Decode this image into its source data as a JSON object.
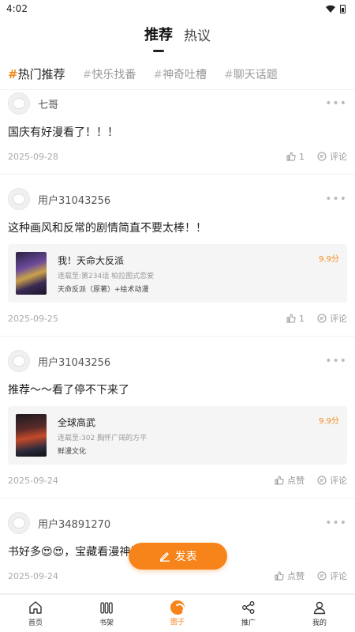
{
  "status": {
    "time": "4:02"
  },
  "tabs": [
    {
      "label": "推荐"
    },
    {
      "label": "热议"
    }
  ],
  "topics": [
    {
      "hash": "#",
      "label": "热门推荐"
    },
    {
      "hash": "#",
      "label": "快乐找番"
    },
    {
      "hash": "#",
      "label": "神奇吐槽"
    },
    {
      "hash": "#",
      "label": "聊天话题"
    }
  ],
  "posts": [
    {
      "user": "七哥",
      "text": "国庆有好漫看了！！！",
      "date": "2025-09-28",
      "like_label": "1",
      "comment_label": "评论"
    },
    {
      "user": "用户31043256",
      "text": "这种画风和反常的剧情简直不要太棒！！",
      "date": "2025-09-25",
      "like_label": "1",
      "comment_label": "评论",
      "comic": {
        "title": "我！天命大反派",
        "sub": "连载至:第234话 柏拉图式恋爱",
        "tags": "天命反派（原著）+绘术动漫",
        "score": "9.9分"
      }
    },
    {
      "user": "用户31043256",
      "text": "推荐～～看了停不下来了",
      "date": "2025-09-24",
      "like_label": "点赞",
      "comment_label": "评论",
      "comic": {
        "title": "全球高武",
        "sub": "连载至:302 胸怀广阔的方平",
        "tags": "鲜漫文化",
        "score": "9.9分"
      }
    },
    {
      "user": "用户34891270",
      "text": "书好多😍😍，宝藏看漫神器呀！！！",
      "date": "2025-09-24",
      "like_label": "点赞",
      "comment_label": "评论"
    }
  ],
  "publish_button": {
    "label": "发表"
  },
  "nav": [
    {
      "label": "首页",
      "icon": "home-icon"
    },
    {
      "label": "书架",
      "icon": "bookshelf-icon"
    },
    {
      "label": "圈子",
      "icon": "circle-icon"
    },
    {
      "label": "推广",
      "icon": "share-icon"
    },
    {
      "label": "我的",
      "icon": "profile-icon"
    }
  ],
  "colors": {
    "accent": "#f7841a",
    "score": "#f28b1e"
  }
}
